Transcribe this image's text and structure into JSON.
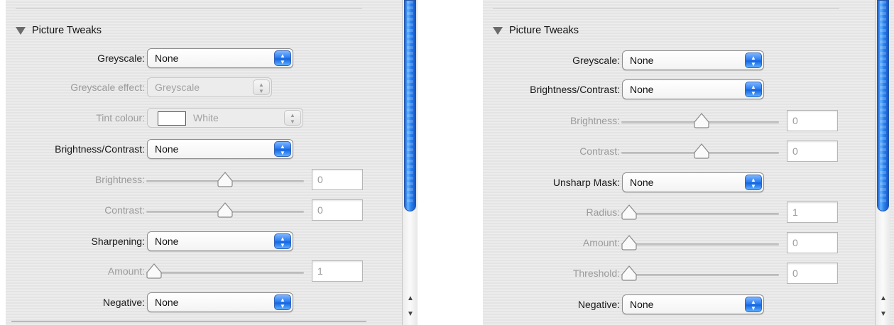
{
  "left": {
    "section_title": "Picture Tweaks",
    "greyscale": {
      "label": "Greyscale:",
      "value": "None"
    },
    "greyscale_effect": {
      "label": "Greyscale effect:",
      "value": "Greyscale"
    },
    "tint_colour": {
      "label": "Tint colour:",
      "value": "White",
      "swatch_color": "#ffffff"
    },
    "brightness_contrast": {
      "label": "Brightness/Contrast:",
      "value": "None"
    },
    "brightness": {
      "label": "Brightness:",
      "value": "0"
    },
    "contrast": {
      "label": "Contrast:",
      "value": "0"
    },
    "sharpening": {
      "label": "Sharpening:",
      "value": "None"
    },
    "amount": {
      "label": "Amount:",
      "value": "1"
    },
    "negative": {
      "label": "Negative:",
      "value": "None"
    },
    "scroll_arrows": {
      "up": "▲",
      "down": "▼"
    }
  },
  "right": {
    "section_title": "Picture Tweaks",
    "greyscale": {
      "label": "Greyscale:",
      "value": "None"
    },
    "brightness_contrast": {
      "label": "Brightness/Contrast:",
      "value": "None"
    },
    "brightness": {
      "label": "Brightness:",
      "value": "0"
    },
    "contrast": {
      "label": "Contrast:",
      "value": "0"
    },
    "unsharp_mask": {
      "label": "Unsharp Mask:",
      "value": "None"
    },
    "radius": {
      "label": "Radius:",
      "value": "1"
    },
    "amount": {
      "label": "Amount:",
      "value": "0"
    },
    "threshold": {
      "label": "Threshold:",
      "value": "0"
    },
    "negative": {
      "label": "Negative:",
      "value": "None"
    },
    "scroll_arrows": {
      "up": "▲",
      "down": "▼"
    }
  },
  "colors": {
    "accent": "#2f7ff2",
    "disabled_text": "#9b9b9b"
  },
  "icons": {
    "disclosure": "disclosure-triangle-icon",
    "popup": "popup-arrows-icon",
    "knob": "slider-knob-icon"
  }
}
